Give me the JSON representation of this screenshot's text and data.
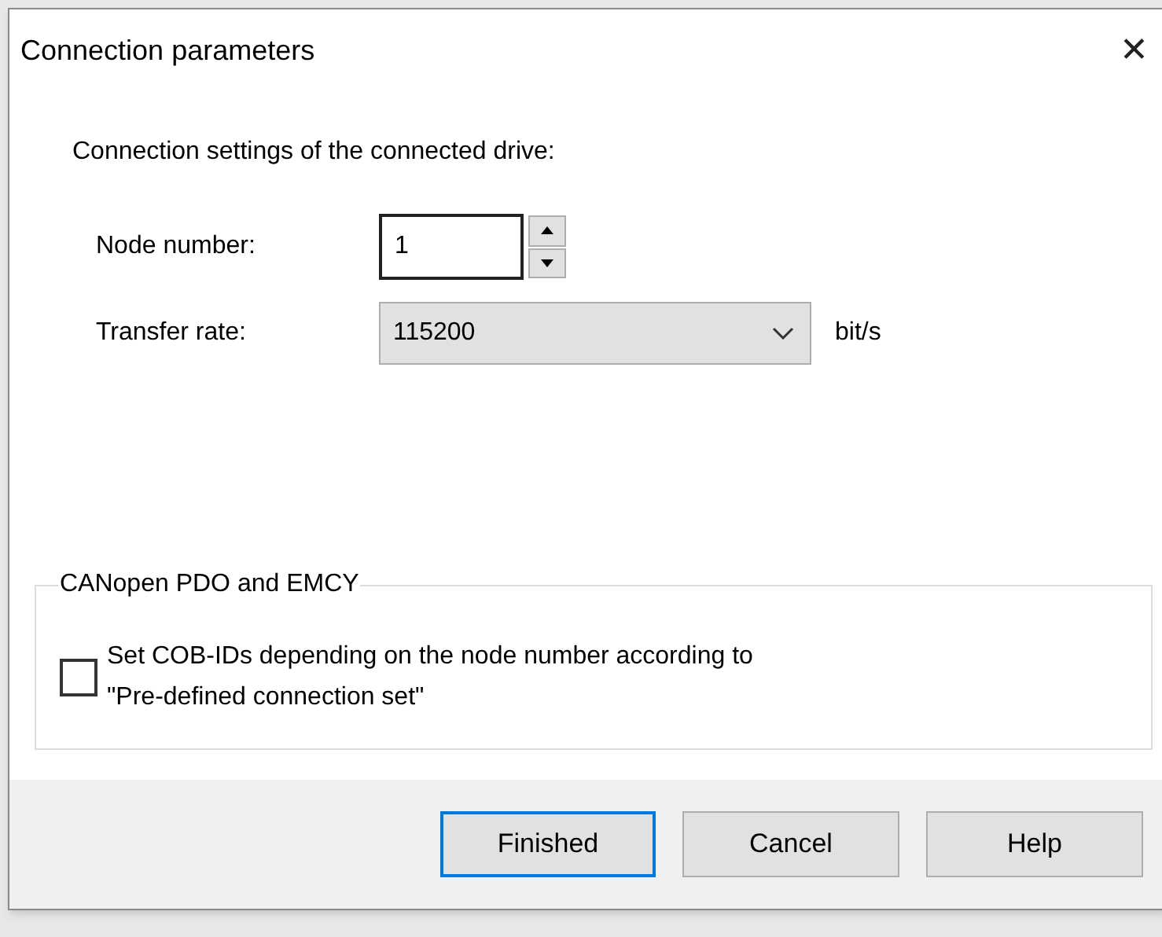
{
  "window": {
    "title": "Connection parameters",
    "close": "✕"
  },
  "intro": "Connection settings of the connected drive:",
  "node_number": {
    "label": "Node number:",
    "value": "1"
  },
  "transfer_rate": {
    "label": "Transfer rate:",
    "value": "115200",
    "unit": "bit/s"
  },
  "group": {
    "title": "CANopen PDO and EMCY",
    "checkbox": {
      "label": "Set COB-IDs depending on the node number according to\n\"Pre-defined connection set\"",
      "checked": false
    }
  },
  "buttons": [
    {
      "label": "Finished",
      "default": true
    },
    {
      "label": "Cancel",
      "default": false
    },
    {
      "label": "Help",
      "default": false
    }
  ]
}
